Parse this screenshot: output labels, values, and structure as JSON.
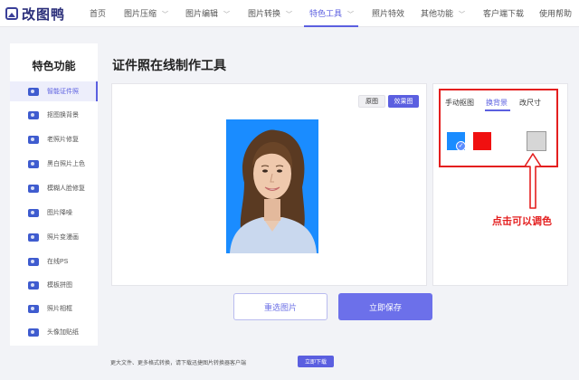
{
  "logo": {
    "text": "改图鸭"
  },
  "nav": [
    {
      "label": "首页",
      "has_menu": false
    },
    {
      "label": "图片压缩",
      "has_menu": true
    },
    {
      "label": "图片编辑",
      "has_menu": true
    },
    {
      "label": "图片转换",
      "has_menu": true
    },
    {
      "label": "特色工具",
      "has_menu": true,
      "active": true
    },
    {
      "label": "照片特效",
      "has_menu": false
    },
    {
      "label": "其他功能",
      "has_menu": true
    },
    {
      "label": "客户端下载",
      "has_menu": false
    },
    {
      "label": "使用帮助",
      "has_menu": false
    }
  ],
  "sidebar": {
    "title": "特色功能",
    "items": [
      {
        "label": "智能证件照",
        "active": true
      },
      {
        "label": "抠图换背景"
      },
      {
        "label": "老照片修复"
      },
      {
        "label": "黑白照片上色"
      },
      {
        "label": "模糊人脸修复"
      },
      {
        "label": "图片降噪"
      },
      {
        "label": "照片变漫画"
      },
      {
        "label": "在线PS"
      },
      {
        "label": "模板拼图"
      },
      {
        "label": "照片相框"
      },
      {
        "label": "头像加贴纸"
      }
    ]
  },
  "main": {
    "title": "证件照在线制作工具",
    "toggle_original": "原图",
    "toggle_effect": "效果图",
    "reselect_button": "重选图片",
    "save_button": "立即保存"
  },
  "right_panel": {
    "tabs": [
      {
        "label": "手动抠图"
      },
      {
        "label": "换背景",
        "active": true
      },
      {
        "label": "改尺寸"
      }
    ],
    "swatches": [
      "#1a8cff",
      "#f01010",
      "#ffffff",
      "#d6d6d6"
    ],
    "selected_swatch": 0
  },
  "annotation": {
    "text": "点击可以调色",
    "color": "#e41f1f"
  },
  "footer": {
    "text": "更大文件、更多格式转换，请下载迅捷图片转换器客户端",
    "button": "立即下载"
  },
  "colors": {
    "accent": "#5b5fe0",
    "photo_background": "#1a8cff"
  }
}
